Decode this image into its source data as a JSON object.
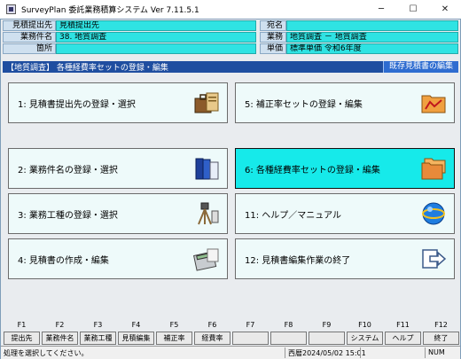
{
  "window": {
    "title": "SurveyPlan 委託業務積算システム Ver 7.11.5.1",
    "minimize": "─",
    "maximize": "☐",
    "close": "✕"
  },
  "info": {
    "submitter_label": "見積提出先",
    "submitter_value": "見積提出先",
    "addressee_label": "宛名",
    "addressee_value": "",
    "work_name_label": "業務件名",
    "work_name_value": "38. 地質調査",
    "business_label": "業務",
    "business_value": "地質調査 － 地質調査",
    "location_label": "箇所",
    "location_value": "",
    "unit_price_label": "単価",
    "unit_price_value": "標準単価 令和6年度"
  },
  "mode_bar": {
    "title": "【地質調査】 各種経費率セットの登録・編集",
    "existing_quote_button": "既存見積書の編集"
  },
  "menu": [
    {
      "label": "1:  見積書提出先の登録・選択",
      "icon": "briefcase-icon",
      "active": false
    },
    {
      "label": "5:  補正率セットの登録・編集",
      "icon": "folder-chart-icon",
      "active": false
    },
    {
      "label": "2:  業務件名の登録・選択",
      "icon": "binders-icon",
      "active": false
    },
    {
      "label": "6:  各種経費率セットの登録・編集",
      "icon": "folders-icon",
      "active": true
    },
    {
      "label": "3:  業務工種の登録・選択",
      "icon": "survey-tools-icon",
      "active": false
    },
    {
      "label": "11:  ヘルプ／マニュアル",
      "icon": "help-globe-icon",
      "active": false
    },
    {
      "label": "4:  見積書の作成・編集",
      "icon": "calculator-icon",
      "active": false
    },
    {
      "label": "12:  見積書編集作業の終了",
      "icon": "exit-icon",
      "active": false
    }
  ],
  "fkeys": [
    {
      "key": "F1",
      "label": "提出先"
    },
    {
      "key": "F2",
      "label": "業務件名"
    },
    {
      "key": "F3",
      "label": "業務工種"
    },
    {
      "key": "F4",
      "label": "見積編集"
    },
    {
      "key": "F5",
      "label": "補正率"
    },
    {
      "key": "F6",
      "label": "経費率"
    },
    {
      "key": "F7",
      "label": ""
    },
    {
      "key": "F8",
      "label": ""
    },
    {
      "key": "F9",
      "label": ""
    },
    {
      "key": "F10",
      "label": "システム"
    },
    {
      "key": "F11",
      "label": "ヘルプ"
    },
    {
      "key": "F12",
      "label": "終了"
    }
  ],
  "status": {
    "message": "処理を選択してください。",
    "datetime": "西暦2024/05/02 15:01",
    "numlock": "NUM"
  }
}
